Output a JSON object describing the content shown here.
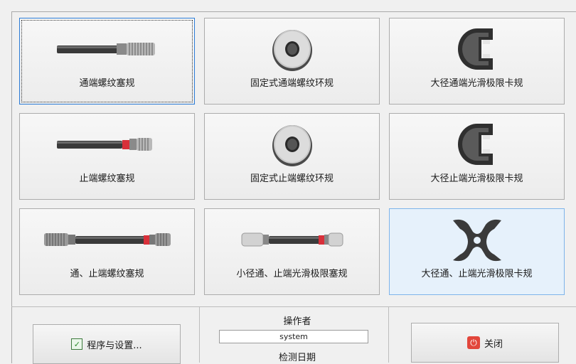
{
  "tiles": [
    {
      "label": "通端螺纹塞规",
      "icon": "thread-plug-gauge-go-icon"
    },
    {
      "label": "固定式通端螺纹环规",
      "icon": "thread-ring-gauge-go-icon"
    },
    {
      "label": "大径通端光滑极限卡规",
      "icon": "snap-gauge-go-icon"
    },
    {
      "label": "止端螺纹塞规",
      "icon": "thread-plug-gauge-nogo-icon"
    },
    {
      "label": "固定式止端螺纹环规",
      "icon": "thread-ring-gauge-nogo-icon"
    },
    {
      "label": "大径止端光滑极限卡规",
      "icon": "snap-gauge-nogo-icon"
    },
    {
      "label": "通、止端螺纹塞规",
      "icon": "thread-plug-gauge-double-icon"
    },
    {
      "label": "小径通、止端光滑极限塞规",
      "icon": "plain-plug-gauge-double-icon"
    },
    {
      "label": "大径通、止端光滑极限卡规",
      "icon": "double-snap-gauge-icon"
    }
  ],
  "footer": {
    "settings_label": "程序与设置...",
    "operator_label": "操作者",
    "operator_value": "system",
    "date_label": "检测日期",
    "close_label": "关闭"
  },
  "colors": {
    "focus": "#2b7bd6",
    "hover_bg": "#e6f1fb",
    "close_icon": "#e2463b",
    "nogo_band": "#d8303a"
  }
}
